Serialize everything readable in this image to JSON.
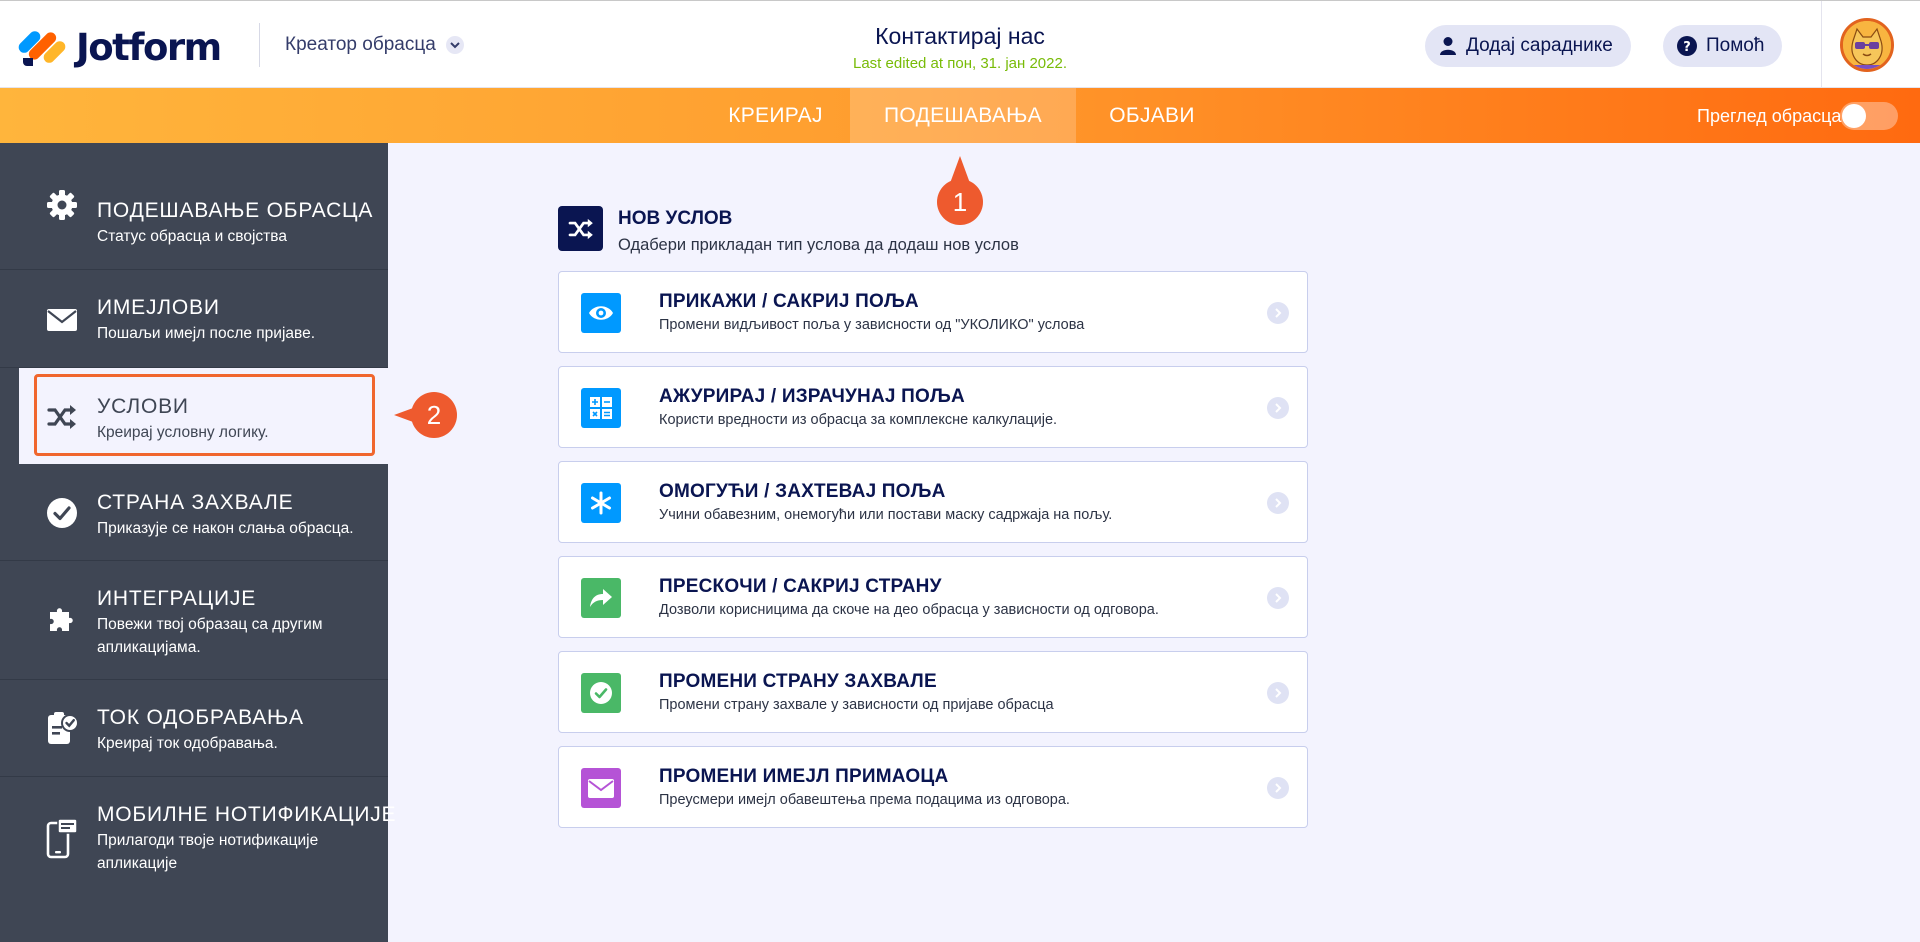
{
  "app": {
    "brand": "Jotform",
    "builder_label": "Креатор обрасца"
  },
  "form": {
    "title": "Контактирај нас",
    "last_edited": "Last edited at пон, 31. јан 2022."
  },
  "header": {
    "add_collaborators": "Додај сараднике",
    "help": "Помоћ"
  },
  "nav": {
    "tabs": [
      {
        "label": "КРЕИРАЈ",
        "active": false
      },
      {
        "label": "ПОДЕШАВАЊА",
        "active": true
      },
      {
        "label": "ОБЈАВИ",
        "active": false
      }
    ],
    "preview_label": "Преглед обрасца",
    "preview_on": false
  },
  "sidebar": {
    "items": [
      {
        "title": "ПОДЕШАВАЊЕ ОБРАСЦА",
        "subtitle": "Статус обрасца и својства",
        "icon": "gear-icon",
        "active": false
      },
      {
        "title": "ИМЕЈЛОВИ",
        "subtitle": "Пошаљи имејл после пријаве.",
        "icon": "envelope-icon",
        "active": false
      },
      {
        "title": "УСЛОВИ",
        "subtitle": "Креирај условну логику.",
        "icon": "shuffle-icon",
        "active": true
      },
      {
        "title": "СТРАНА ЗАХВАЛЕ",
        "subtitle": "Приказује се након слања обрасца.",
        "icon": "check-circle-icon",
        "active": false
      },
      {
        "title": "ИНТЕГРАЦИЈЕ",
        "subtitle": "Повежи твој образац са другим апликацијама.",
        "icon": "puzzle-icon",
        "active": false
      },
      {
        "title": "ТОК ОДОБРАВАЊА",
        "subtitle": "Креирај ток одобравања.",
        "icon": "approval-icon",
        "active": false
      },
      {
        "title": "МОБИЛНЕ НОТИФИКАЦИЈЕ",
        "subtitle": "Прилагоди твоје нотификације апликације",
        "icon": "mobile-notification-icon",
        "active": false
      }
    ]
  },
  "callouts": {
    "first": "1",
    "second": "2"
  },
  "conditions": {
    "title": "НОВ УСЛОВ",
    "subtitle": "Одабери прикладан тип услова да додаш нов услов",
    "cards": [
      {
        "title": "ПРИКАЖИ / САКРИЈ ПОЉА",
        "desc": "Промени видљивост поља у зависности од \"УКОЛИКО\" услова",
        "icon": "eye-icon",
        "color": "#0099ff"
      },
      {
        "title": "АЖУРИРАЈ / ИЗРАЧУНАЈ ПОЉА",
        "desc": "Користи вредности из обрасца за комплексне калкулације.",
        "icon": "calculator-icon",
        "color": "#0099ff"
      },
      {
        "title": "ОМОГУЋИ / ЗАХТЕВАЈ ПОЉА",
        "desc": "Учини обавезним, онемогући или постави маску садржаја на пољу.",
        "icon": "asterisk-icon",
        "color": "#0099ff"
      },
      {
        "title": "ПРЕСКОЧИ / САКРИЈ СТРАНУ",
        "desc": "Дозволи корисницима да скоче на део обрасца у зависности од одговора.",
        "icon": "share-arrow-icon",
        "color": "#4ab867"
      },
      {
        "title": "ПРОМЕНИ СТРАНУ ЗАХВАЛЕ",
        "desc": "Промени страну захвале у зависности од пријаве обрасца",
        "icon": "check-circle-icon",
        "color": "#4ab867"
      },
      {
        "title": "ПРОМЕНИ ИМЕЈЛ ПРИМАОЦА",
        "desc": "Преусмери имејл обавештења према подацима из одговора.",
        "icon": "envelope-icon",
        "color": "#b553d6"
      }
    ]
  },
  "colors": {
    "accent_orange": "#ff6a10",
    "navy": "#0a1551",
    "sidebar": "#3f4654",
    "callout": "#ee5a2e"
  }
}
